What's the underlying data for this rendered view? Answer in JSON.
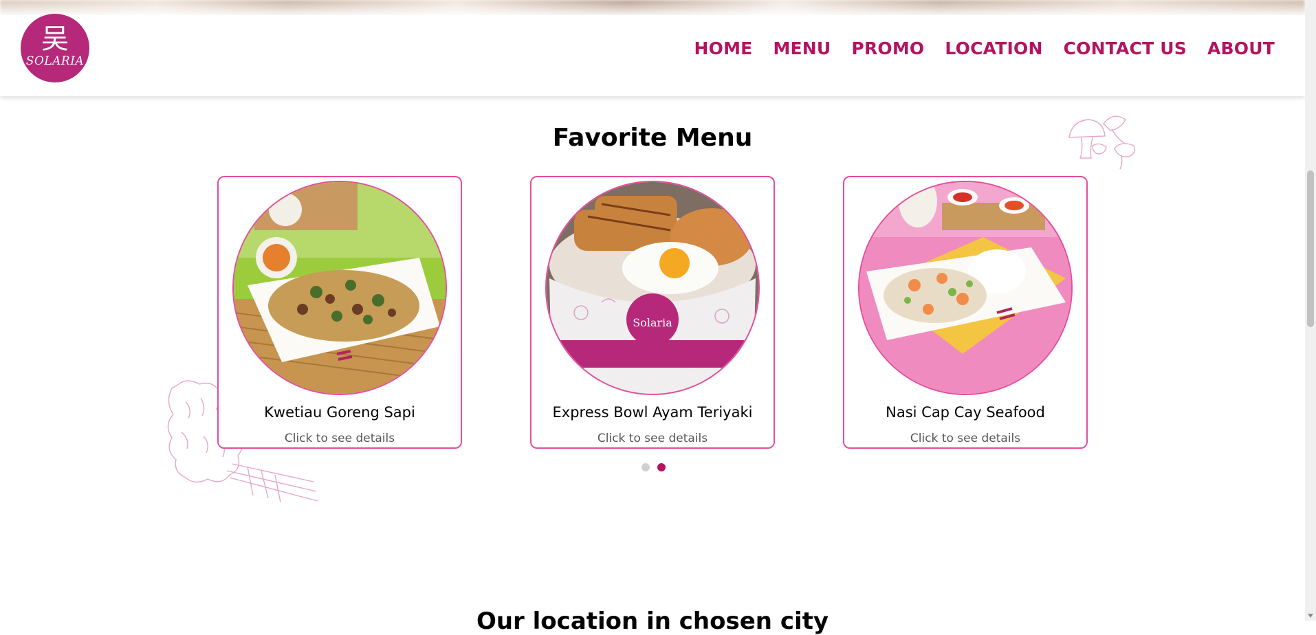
{
  "header": {
    "logo_text": "SOLARIA",
    "nav": [
      {
        "label": "HOME"
      },
      {
        "label": "MENU"
      },
      {
        "label": "PROMO"
      },
      {
        "label": "LOCATION"
      },
      {
        "label": "CONTACT US"
      },
      {
        "label": "ABOUT"
      }
    ]
  },
  "favorite_menu": {
    "title": "Favorite Menu",
    "items": [
      {
        "name": "Kwetiau Goreng Sapi",
        "hint": "Click to see details"
      },
      {
        "name": "Express Bowl Ayam Teriyaki",
        "hint": "Click to see details"
      },
      {
        "name": "Nasi Cap Cay Seafood",
        "hint": "Click to see details"
      }
    ],
    "pagination": {
      "pages": 2,
      "active_page": 2
    }
  },
  "next_section": {
    "title_partial": "Our location in chosen city"
  },
  "colors": {
    "brand": "#b5135f",
    "logo_bg": "#b5287a",
    "card_border": "#e54d9b"
  }
}
